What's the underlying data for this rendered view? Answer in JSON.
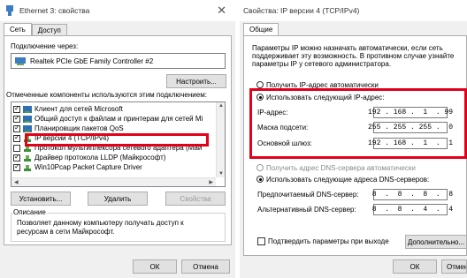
{
  "left": {
    "title": "Ethernet 3: свойства",
    "close": "✕",
    "tabs": [
      "Сеть",
      "Доступ"
    ],
    "connect_via_label": "Подключение через:",
    "adapter_name": "Realtek PCIe GbE Family Controller #2",
    "configure_button": "Настроить...",
    "components_label": "Отмеченные компоненты используются этим подключением:",
    "components": [
      {
        "label": "Клиент для сетей Microsoft",
        "checked": true,
        "icon": "network"
      },
      {
        "label": "Общий доступ к файлам и принтерам для сетей Mi",
        "checked": true,
        "icon": "network"
      },
      {
        "label": "Планировщик пакетов QoS",
        "checked": true,
        "icon": "network"
      },
      {
        "label": "IP версии 4 (TCP/IPv4)",
        "checked": true,
        "icon": "protocol"
      },
      {
        "label": "Протокол мультиплексора сетевого адаптера (Май",
        "checked": false,
        "icon": "protocol"
      },
      {
        "label": "Драйвер протокола LLDP (Майкрософт)",
        "checked": true,
        "icon": "protocol"
      },
      {
        "label": "Win10Pcap Packet Capture Driver",
        "checked": true,
        "icon": "protocol"
      }
    ],
    "install_button": "Установить...",
    "remove_button": "Удалить",
    "properties_button": "Свойства",
    "description_label": "Описание",
    "description_text_1": "Позволяет данному компьютеру получать доступ к",
    "description_text_2": "ресурсам в сети Майкрософт.",
    "ok_button": "ОК",
    "cancel_button": "Отмена"
  },
  "right": {
    "title": "Свойства: IP версии 4 (TCP/IPv4)",
    "tab": "Общие",
    "intro_1": "Параметры IP можно назначать автоматически, если сеть",
    "intro_2": "поддерживает эту возможность. В противном случае узнайте",
    "intro_3": "параметры IP у сетевого администратора.",
    "auto_ip_radio": "Получить IP-адрес автоматически",
    "manual_ip_radio": "Использовать следующий IP-адрес:",
    "ip_label": "IP-адрес:",
    "ip_value": "192 . 168 .  1  . 99",
    "mask_label": "Маска подсети:",
    "mask_value": "255 . 255 . 255 .  0",
    "gateway_label": "Основной шлюз:",
    "gateway_value": "192 . 168 .  1  .  1",
    "auto_dns_radio": "Получить адрес DNS-сервера автоматически",
    "manual_dns_radio": "Использовать следующие адреса DNS-серверов:",
    "preferred_dns_label": "Предпочитаемый DNS-сервер:",
    "preferred_dns_value": " 8  .  8  .  8  .  8",
    "alternate_dns_label": "Альтернативный DNS-сервер:",
    "alternate_dns_value": " 8  .  8  .  4  .  4",
    "validate_checkbox": "Подтвердить параметры при выходе",
    "advanced_button": "Дополнительно...",
    "ok_button": "ОК",
    "cancel_button": "Отмена"
  },
  "colors": {
    "highlight": "#e2001a",
    "window_bg": "#f0f0f0",
    "button_bg": "#e1e1e1"
  }
}
